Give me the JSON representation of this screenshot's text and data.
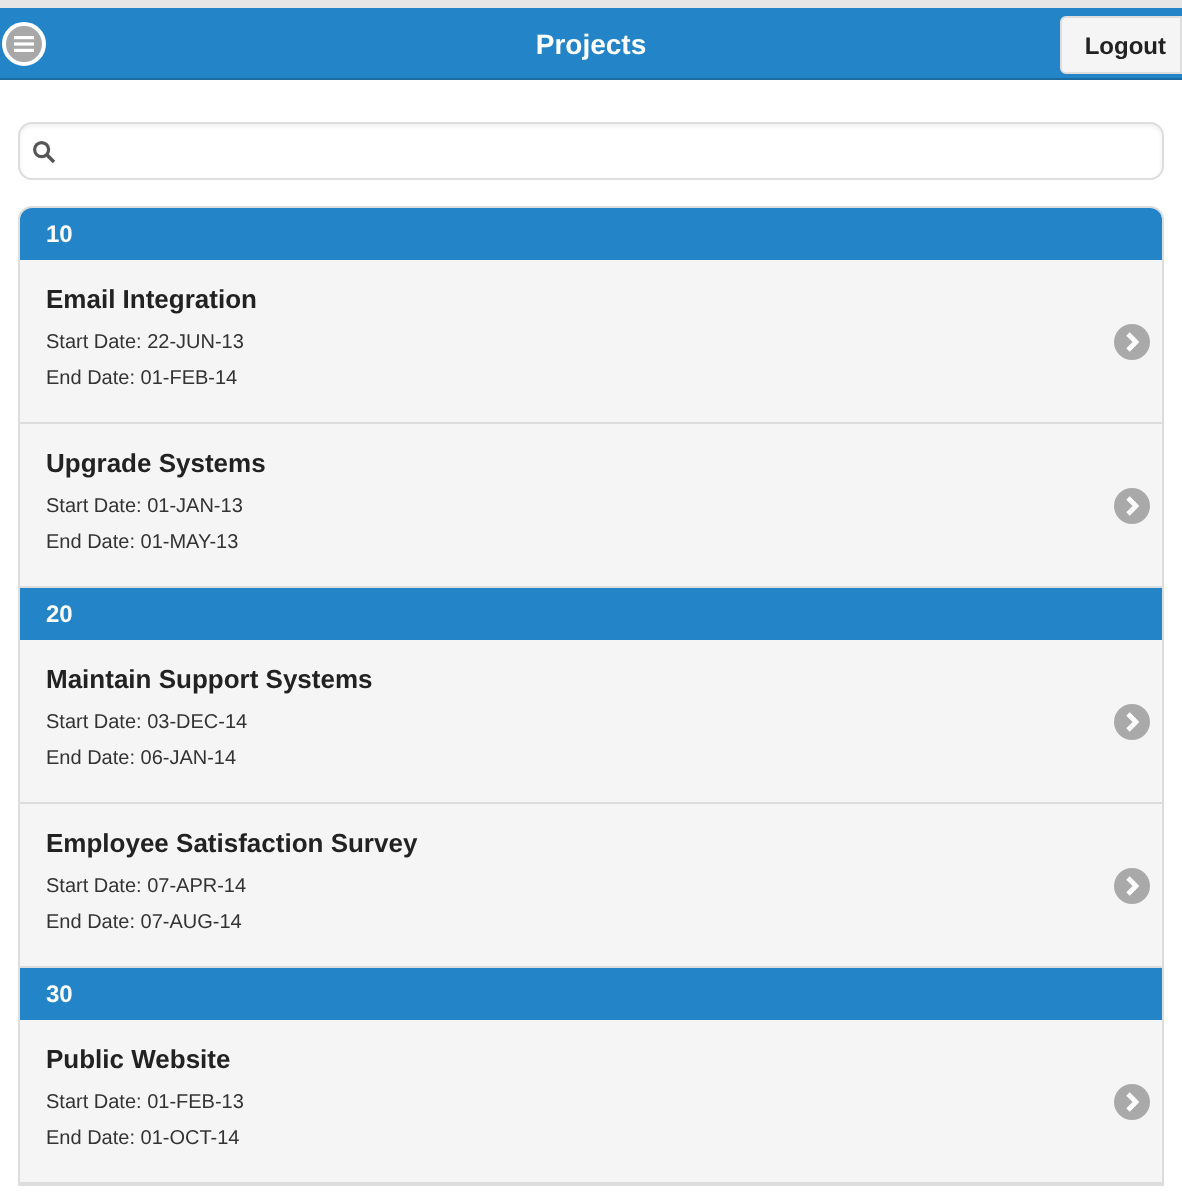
{
  "header": {
    "title": "Projects",
    "logout": "Logout"
  },
  "groups": [
    {
      "label": "10",
      "items": [
        {
          "name": "Email Integration",
          "start": "Start Date: 22-JUN-13",
          "end": "End Date: 01-FEB-14"
        },
        {
          "name": "Upgrade Systems",
          "start": "Start Date: 01-JAN-13",
          "end": "End Date: 01-MAY-13"
        }
      ]
    },
    {
      "label": "20",
      "items": [
        {
          "name": "Maintain Support Systems",
          "start": "Start Date: 03-DEC-14",
          "end": "End Date: 06-JAN-14"
        },
        {
          "name": "Employee Satisfaction Survey",
          "start": "Start Date: 07-APR-14",
          "end": "End Date: 07-AUG-14"
        }
      ]
    },
    {
      "label": "30",
      "items": [
        {
          "name": "Public Website",
          "start": "Start Date: 01-FEB-13",
          "end": "End Date: 01-OCT-14"
        }
      ]
    }
  ]
}
